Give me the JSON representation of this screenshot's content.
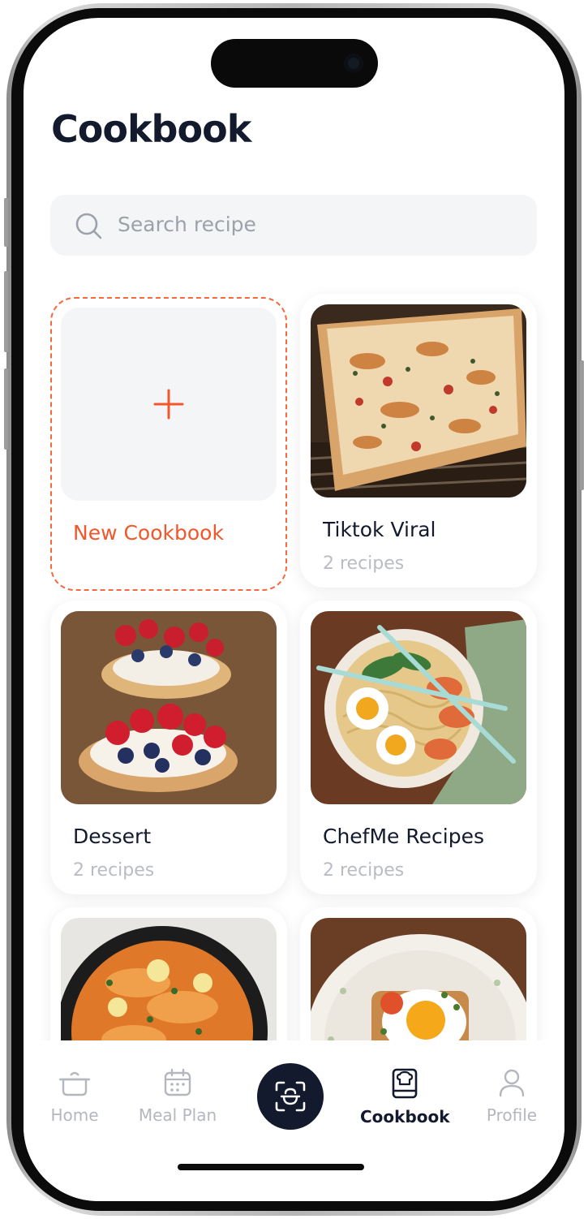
{
  "screen": {
    "title": "Cookbook"
  },
  "search": {
    "placeholder": "Search recipe",
    "icon": "search-icon"
  },
  "new_cookbook": {
    "label": "New Cookbook",
    "icon": "plus-icon",
    "accent": "#f26a3d"
  },
  "cookbooks": [
    {
      "name": "Tiktok Viral",
      "count": "2 recipes",
      "image": "baked-casserole-photo"
    },
    {
      "name": "Dessert",
      "count": "2 recipes",
      "image": "berry-tart-photo"
    },
    {
      "name": "ChefMe Recipes",
      "count": "2 recipes",
      "image": "ramen-bowl-photo"
    },
    {
      "name": "",
      "count": "",
      "image": "curry-skillet-photo"
    },
    {
      "name": "",
      "count": "",
      "image": "egg-toast-plate-photo"
    }
  ],
  "nav": {
    "items": [
      {
        "label": "Home",
        "icon": "pot-icon"
      },
      {
        "label": "Meal Plan",
        "icon": "calendar-icon"
      },
      {
        "label": "Cookbook",
        "icon": "cookbook-icon",
        "active": true
      },
      {
        "label": "Profile",
        "icon": "user-icon"
      }
    ],
    "center_action": {
      "icon": "scan-icon"
    }
  },
  "colors": {
    "primary_dark": "#141a2e",
    "accent": "#f26a3d",
    "muted": "#b4b7bd"
  }
}
